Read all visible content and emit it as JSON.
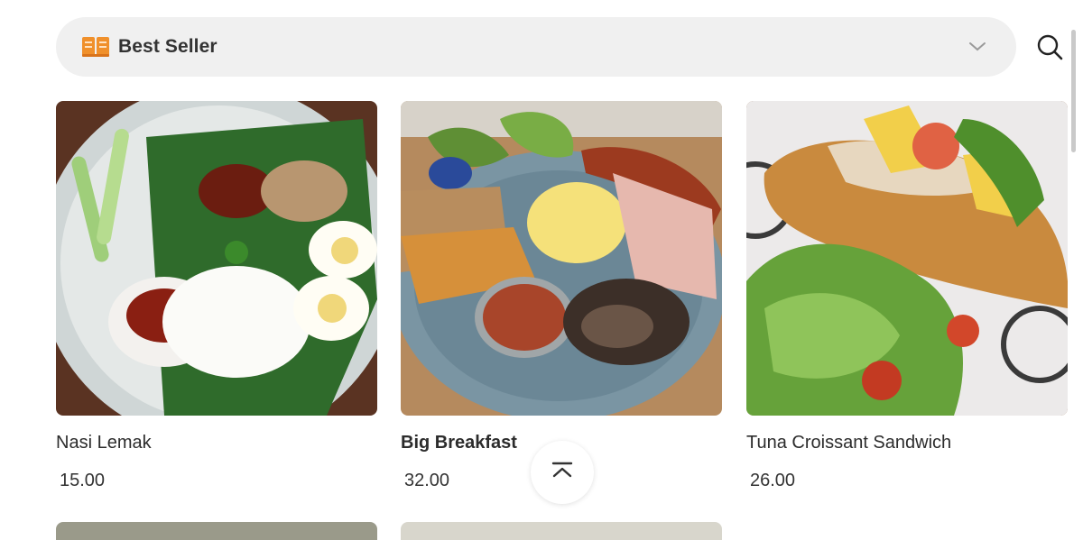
{
  "category_bar": {
    "icon": "book-icon",
    "label": "Best Seller",
    "dropdown_icon": "chevron-down-icon"
  },
  "search": {
    "icon": "search-icon"
  },
  "products": [
    {
      "name": "Nasi Lemak",
      "price": "15.00"
    },
    {
      "name": "Big Breakfast",
      "price": "32.00"
    },
    {
      "name": "Tuna Croissant Sandwich",
      "price": "26.00"
    }
  ],
  "scroll_top_button": {
    "icon": "chevron-up-bar-icon"
  },
  "colors": {
    "category_icon": "#f0902b",
    "bar_background": "#f0f0f0",
    "text": "#2c2c2c"
  }
}
